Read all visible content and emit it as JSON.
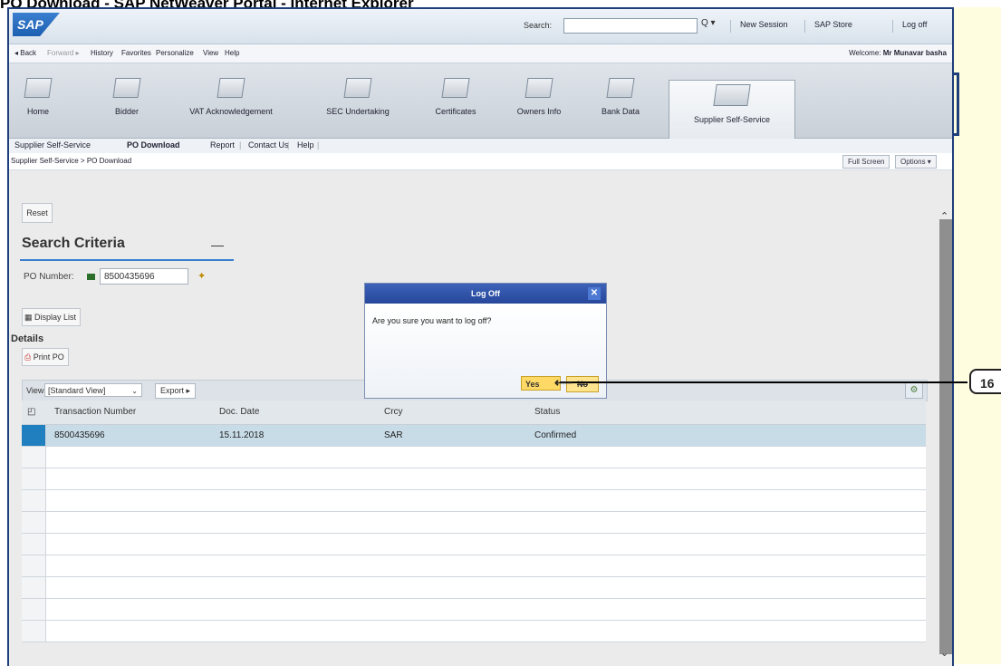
{
  "page_heading": "PO Download - SAP NetWeaver Portal - Internet Explorer",
  "header": {
    "logo": "SAP",
    "search_label": "Search:",
    "search_value": "",
    "search_dropdown": "Q ▾",
    "links": [
      "New Session",
      "SAP Store",
      "Log off"
    ]
  },
  "toolbar": {
    "items": [
      "◂ Back",
      "Forward ▸",
      "History",
      "Favorites",
      "Personalize",
      "View",
      "Help"
    ],
    "welcome_prefix": "Welcome:",
    "welcome_user": "Mr Munavar basha"
  },
  "nav_tiles": [
    "Home",
    "Bidder",
    "VAT Acknowledgement",
    "SEC Undertaking",
    "Certificates",
    "Owners Info",
    "Bank Data",
    "Supplier Self-Service"
  ],
  "subnav": [
    "Supplier Self-Service",
    "PO Download",
    "Report",
    "Contact Us",
    "Help"
  ],
  "breadcrumb": "Supplier Self-Service  >  PO Download",
  "page_buttons": {
    "full_screen": "Full Screen",
    "options": "Options ▾"
  },
  "form": {
    "reset": "Reset",
    "search_criteria": "Search Criteria",
    "collapse": "—",
    "po_label": "PO Number:",
    "po_value": "8500435696",
    "display_list": "Display List",
    "details": "Details",
    "print_po": "Print PO"
  },
  "table_toolbar": {
    "view_label": "View",
    "view_value": "[Standard View]",
    "export": "Export ▸"
  },
  "table": {
    "headers": [
      "Transaction Number",
      "Doc. Date",
      "Crcy",
      "Status"
    ],
    "rows": [
      {
        "transaction": "8500435696",
        "date": "15.11.2018",
        "currency": "SAR",
        "status": "Confirmed"
      }
    ]
  },
  "dialog": {
    "title": "Log Off",
    "message": "Are you sure you want to log off?",
    "yes": "Yes",
    "no": "No"
  },
  "callout": "16"
}
